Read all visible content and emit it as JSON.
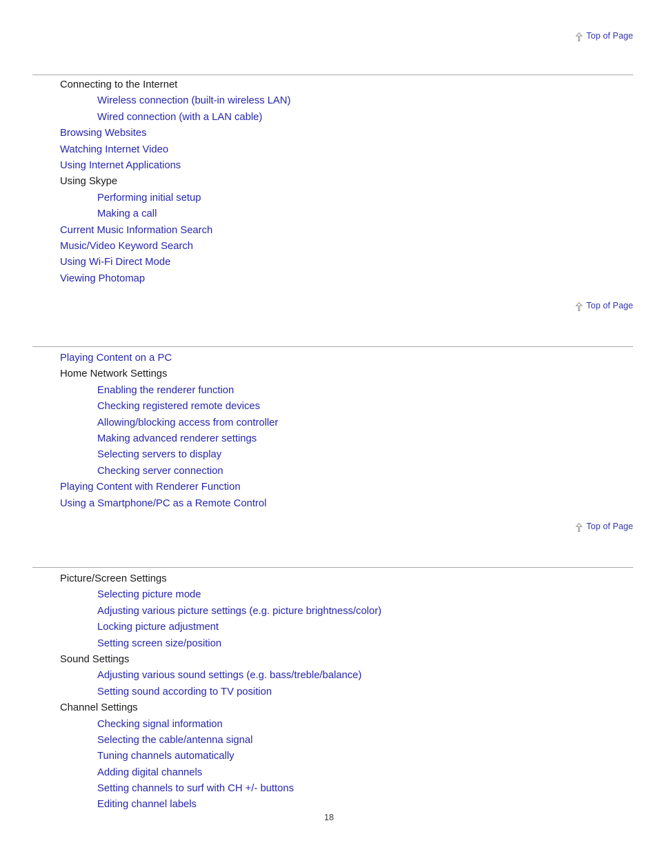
{
  "document": {
    "page_number": "18",
    "accent_link_color": "#2727a8",
    "body_text_color": "#1a1a1a",
    "rule_color": "#a8a8a8",
    "arrow_icon_color": "#999999"
  },
  "top_of_page_links": [
    {
      "icon": "arrow-up-icon",
      "label": "Top of Page"
    },
    {
      "icon": "arrow-up-icon",
      "label": "Top of Page"
    },
    {
      "icon": "arrow-up-icon",
      "label": "Top of Page"
    }
  ],
  "sections": [
    {
      "id": "network-internet",
      "entries": [
        {
          "label": "Connecting to the Internet",
          "level": 0,
          "link": false
        },
        {
          "label": "Wireless connection (built-in wireless LAN)",
          "level": 1,
          "link": true
        },
        {
          "label": "Wired connection (with a LAN cable)",
          "level": 1,
          "link": true
        },
        {
          "label": "Browsing Websites",
          "level": 0,
          "link": true
        },
        {
          "label": "Watching Internet Video",
          "level": 0,
          "link": true
        },
        {
          "label": "Using Internet Applications",
          "level": 0,
          "link": true
        },
        {
          "label": "Using Skype",
          "level": 0,
          "link": false
        },
        {
          "label": "Performing initial setup",
          "level": 1,
          "link": true
        },
        {
          "label": "Making a call",
          "level": 1,
          "link": true
        },
        {
          "label": "Current Music Information Search",
          "level": 0,
          "link": true
        },
        {
          "label": "Music/Video Keyword Search",
          "level": 0,
          "link": true
        },
        {
          "label": "Using Wi-Fi Direct Mode",
          "level": 0,
          "link": true
        },
        {
          "label": "Viewing Photomap",
          "level": 0,
          "link": true
        }
      ]
    },
    {
      "id": "home-network",
      "entries": [
        {
          "label": "Playing Content on a PC",
          "level": 0,
          "link": true
        },
        {
          "label": "Home Network Settings",
          "level": 0,
          "link": false
        },
        {
          "label": "Enabling the renderer function",
          "level": 1,
          "link": true
        },
        {
          "label": "Checking registered remote devices",
          "level": 1,
          "link": true
        },
        {
          "label": "Allowing/blocking access from controller",
          "level": 1,
          "link": true
        },
        {
          "label": "Making advanced renderer settings",
          "level": 1,
          "link": true
        },
        {
          "label": "Selecting servers to display",
          "level": 1,
          "link": true
        },
        {
          "label": "Checking server connection",
          "level": 1,
          "link": true
        },
        {
          "label": "Playing Content with Renderer Function",
          "level": 0,
          "link": true
        },
        {
          "label": "Using a Smartphone/PC as a Remote Control",
          "level": 0,
          "link": true
        }
      ]
    },
    {
      "id": "settings",
      "entries": [
        {
          "label": "Picture/Screen Settings",
          "level": 0,
          "link": false
        },
        {
          "label": "Selecting picture mode",
          "level": 1,
          "link": true
        },
        {
          "label": "Adjusting various picture settings (e.g. picture brightness/color)",
          "level": 1,
          "link": true
        },
        {
          "label": "Locking picture adjustment",
          "level": 1,
          "link": true
        },
        {
          "label": "Setting screen size/position",
          "level": 1,
          "link": true
        },
        {
          "label": "Sound Settings",
          "level": 0,
          "link": false
        },
        {
          "label": "Adjusting various sound settings (e.g. bass/treble/balance)",
          "level": 1,
          "link": true
        },
        {
          "label": "Setting sound according to TV position",
          "level": 1,
          "link": true
        },
        {
          "label": "Channel Settings",
          "level": 0,
          "link": false
        },
        {
          "label": "Checking signal information",
          "level": 1,
          "link": true
        },
        {
          "label": "Selecting the cable/antenna signal",
          "level": 1,
          "link": true
        },
        {
          "label": "Tuning channels automatically",
          "level": 1,
          "link": true
        },
        {
          "label": "Adding digital channels",
          "level": 1,
          "link": true
        },
        {
          "label": "Setting channels to surf with CH +/- buttons",
          "level": 1,
          "link": true
        },
        {
          "label": "Editing channel labels",
          "level": 1,
          "link": true
        }
      ]
    }
  ]
}
